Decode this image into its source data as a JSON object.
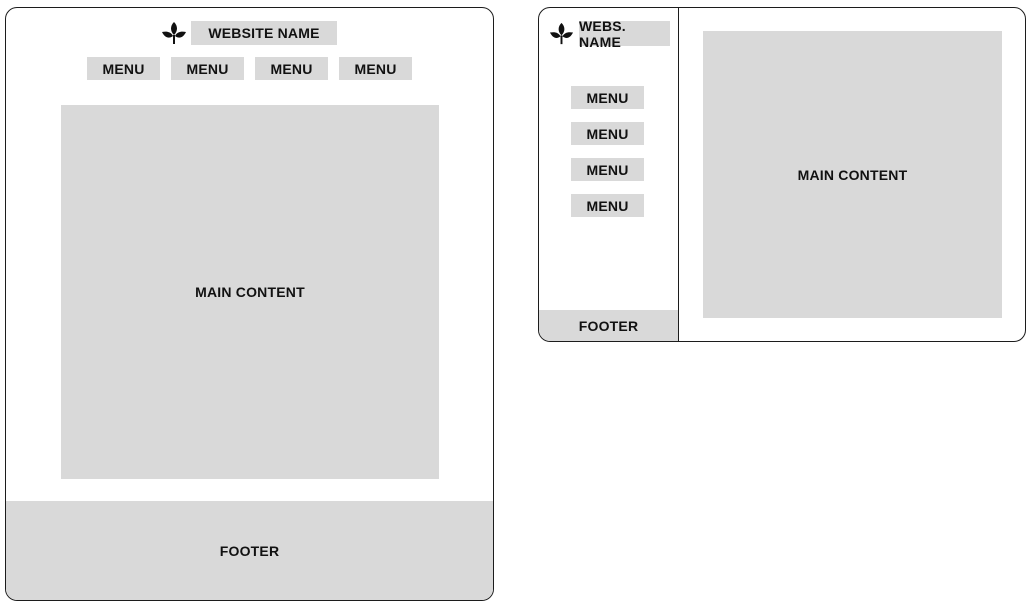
{
  "layout_top_nav": {
    "brand": {
      "icon": "leaf-logo-icon",
      "name": "WEBSITE NAME"
    },
    "menu": [
      "MENU",
      "MENU",
      "MENU",
      "MENU"
    ],
    "main": "MAIN CONTENT",
    "footer": "FOOTER"
  },
  "layout_sidebar": {
    "brand": {
      "icon": "leaf-logo-icon",
      "name": "WEBS. NAME"
    },
    "menu": [
      "MENU",
      "MENU",
      "MENU",
      "MENU"
    ],
    "main": "MAIN CONTENT",
    "footer": "FOOTER"
  },
  "colors": {
    "block": "#d9d9d9",
    "outline": "#1c1c1c"
  }
}
